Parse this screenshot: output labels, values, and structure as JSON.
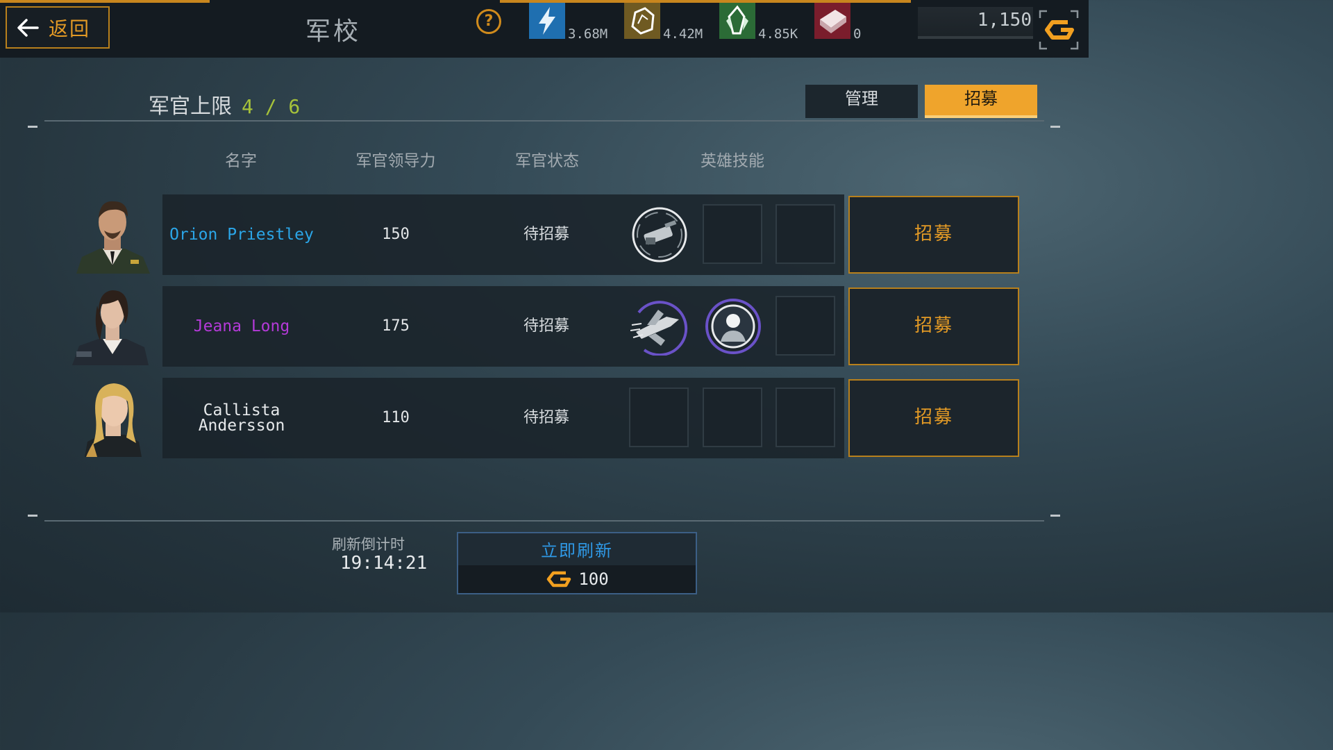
{
  "header": {
    "back_label": "返回",
    "title": "军校",
    "help_symbol": "?",
    "resources": [
      {
        "icon": "energy-bolt-icon",
        "value": "3.68M",
        "color": "#1f6fb0"
      },
      {
        "icon": "ore-icon",
        "value": "4.42M",
        "color": "#6f5a22"
      },
      {
        "icon": "crystal-icon",
        "value": "4.85K",
        "color": "#2b6b36"
      },
      {
        "icon": "supply-crate-icon",
        "value": "0",
        "color": "#7a1d2c"
      }
    ],
    "gold": {
      "value": "1,150",
      "icon": "gold-currency-icon"
    }
  },
  "officer_cap": {
    "label": "军官上限",
    "value": "4 / 6"
  },
  "tabs": {
    "manage": "管理",
    "recruit": "招募",
    "active": "recruit"
  },
  "table": {
    "headers": [
      "名字",
      "军官领导力",
      "军官状态",
      "英雄技能"
    ],
    "rows": [
      {
        "name": "Orion Priestley",
        "name_color": "#2ba6e8",
        "leadership": "150",
        "status": "待招募",
        "skills": [
          "gatling-turret-skill-icon",
          "",
          ""
        ],
        "button": "招募"
      },
      {
        "name": "Jeana Long",
        "name_color": "#b43ad8",
        "leadership": "175",
        "status": "待招募",
        "skills": [
          "fighter-jet-skill-icon",
          "commander-skill-icon",
          ""
        ],
        "button": "招募"
      },
      {
        "name": "Callista Andersson",
        "name_color": "#e6e9eb",
        "leadership": "110",
        "status": "待招募",
        "skills": [
          "",
          "",
          ""
        ],
        "button": "招募"
      }
    ]
  },
  "refresh": {
    "countdown_label": "刷新倒计时",
    "countdown": "19:14:21",
    "button_label": "立即刷新",
    "cost": "100"
  },
  "colors": {
    "accent": "#e39a25",
    "tab_active": "#efa42c",
    "link_blue": "#2f99e6"
  }
}
